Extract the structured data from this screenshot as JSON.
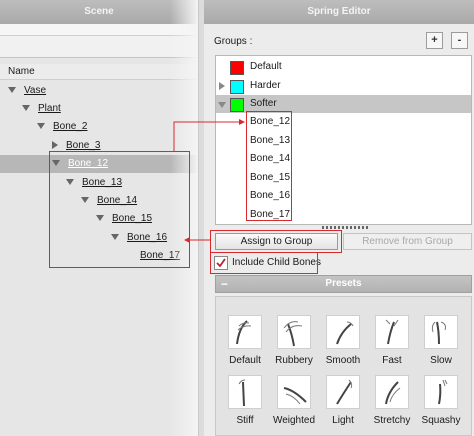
{
  "scene": {
    "title": "Scene",
    "column_header": "Name",
    "tree": [
      {
        "label": "Vase",
        "expander": "down"
      },
      {
        "label": "Plant",
        "expander": "down"
      },
      {
        "label": "Bone_2",
        "expander": "down"
      },
      {
        "label": "Bone_3",
        "expander": "right"
      },
      {
        "label": "Bone_12",
        "expander": "down",
        "selected": true
      },
      {
        "label": "Bone_13",
        "expander": "down"
      },
      {
        "label": "Bone_14",
        "expander": "down"
      },
      {
        "label": "Bone_15",
        "expander": "down"
      },
      {
        "label": "Bone_16",
        "expander": "down"
      },
      {
        "label": "Bone_17",
        "expander": "none"
      }
    ]
  },
  "spring_editor": {
    "title": "Spring Editor",
    "groups_label": "Groups :",
    "add_label": "+",
    "remove_label": "-",
    "groups": [
      {
        "label": "Default",
        "color": "#ff0000",
        "expander": "none"
      },
      {
        "label": "Harder",
        "color": "#00ffff",
        "expander": "right"
      },
      {
        "label": "Softer",
        "color": "#00ff00",
        "expander": "down",
        "selected": true
      }
    ],
    "group_bones": [
      "Bone_12",
      "Bone_13",
      "Bone_14",
      "Bone_15",
      "Bone_16",
      "Bone_17"
    ],
    "assign_button": "Assign to Group",
    "remove_button": "Remove from Group",
    "include_child_bones": {
      "label": "Include Child Bones",
      "checked": true
    },
    "presets": {
      "title": "Presets",
      "collapse_symbol": "−",
      "items": [
        {
          "label": "Default",
          "icon": "spring-default-icon"
        },
        {
          "label": "Rubbery",
          "icon": "spring-rubbery-icon"
        },
        {
          "label": "Smooth",
          "icon": "spring-smooth-icon"
        },
        {
          "label": "Fast",
          "icon": "spring-fast-icon"
        },
        {
          "label": "Slow",
          "icon": "spring-slow-icon"
        },
        {
          "label": "Stiff",
          "icon": "spring-stiff-icon"
        },
        {
          "label": "Weighted",
          "icon": "spring-weighted-icon"
        },
        {
          "label": "Light",
          "icon": "spring-light-icon"
        },
        {
          "label": "Stretchy",
          "icon": "spring-stretchy-icon"
        },
        {
          "label": "Squashy",
          "icon": "spring-squashy-icon"
        }
      ]
    }
  },
  "colors": {
    "annotation": "#d8292f",
    "selection": "#b7b7b7"
  }
}
